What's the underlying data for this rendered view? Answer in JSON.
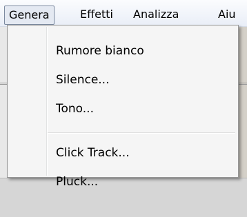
{
  "menubar": {
    "items": [
      {
        "label": "Genera"
      },
      {
        "label": "Effetti"
      },
      {
        "label": "Analizza"
      },
      {
        "label": "Aiu"
      }
    ]
  },
  "dropdown": {
    "items": [
      {
        "label": "Rumore bianco"
      },
      {
        "label": "Silence..."
      },
      {
        "label": "Tono..."
      },
      {
        "label": "Click Track..."
      },
      {
        "label": "Pluck..."
      }
    ]
  }
}
